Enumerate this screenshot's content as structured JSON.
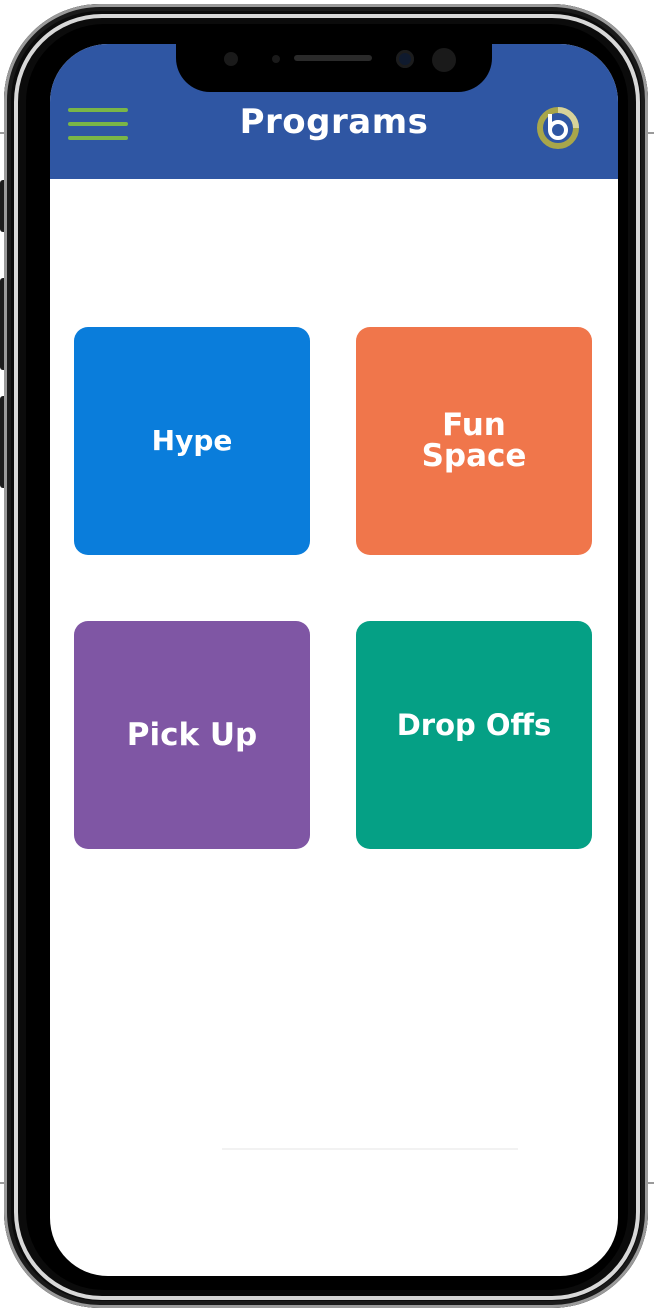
{
  "app": {
    "title": "Programs"
  },
  "header": {
    "menu_icon": "hamburger-menu-icon",
    "logo_icon": "brand-logo-icon",
    "background_color": "#2f56a3",
    "accent_color": "#7ab648"
  },
  "tiles": [
    {
      "label": "Hype",
      "color": "#0a7ddb"
    },
    {
      "label": "Fun Space",
      "color": "#f0764b"
    },
    {
      "label": "Pick Up",
      "color": "#7f56a4"
    },
    {
      "label": "Drop Offs",
      "color": "#05a085"
    }
  ]
}
